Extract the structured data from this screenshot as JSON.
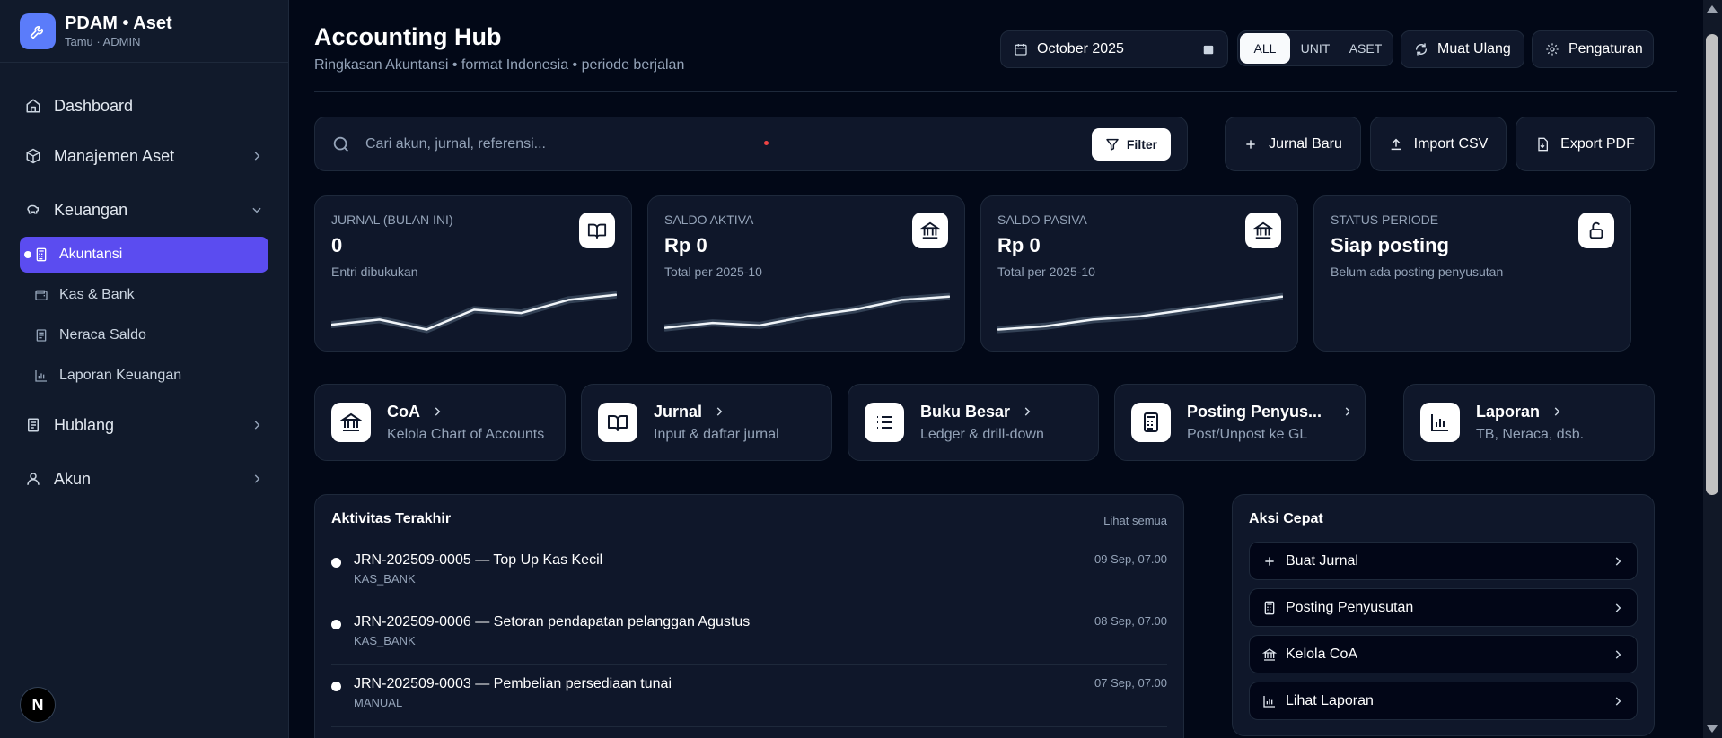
{
  "brand": {
    "title": "PDAM • Aset",
    "subtitle": "Tamu · ADMIN"
  },
  "sidebar": {
    "dashboard": "Dashboard",
    "aset": "Manajemen Aset",
    "keuangan": "Keuangan",
    "sub_items": [
      "Akuntansi",
      "Kas & Bank",
      "Neraca Saldo",
      "Laporan Keuangan"
    ],
    "hublang": "Hublang",
    "akun": "Akun",
    "badge": "N"
  },
  "header": {
    "title": "Accounting Hub",
    "subtitle": "Ringkasan Akuntansi • format Indonesia • periode berjalan",
    "period": "October 2025",
    "segments": [
      "ALL",
      "UNIT",
      "ASET"
    ],
    "reload": "Muat Ulang",
    "settings": "Pengaturan"
  },
  "toolbar": {
    "search_placeholder": "Cari akun, jurnal, referensi...",
    "filter": "Filter",
    "new_journal": "Jurnal Baru",
    "import": "Import CSV",
    "export": "Export PDF"
  },
  "kpis": [
    {
      "label": "Jurnal (bulan ini)",
      "value": "0",
      "note": "Entri dibukukan",
      "icon": "book-icon",
      "spark": [
        12,
        18,
        6,
        30,
        26,
        42,
        48
      ]
    },
    {
      "label": "Saldo Aktiva",
      "value": "Rp 0",
      "note": "Total per 2025-10",
      "icon": "bank-icon",
      "spark": [
        8,
        14,
        11,
        22,
        30,
        42,
        46
      ]
    },
    {
      "label": "Saldo Pasiva",
      "value": "Rp 0",
      "note": "Total per 2025-10",
      "icon": "bank-icon",
      "spark": [
        6,
        10,
        18,
        22,
        30,
        38,
        46
      ]
    },
    {
      "label": "Status Periode",
      "value": "Siap posting",
      "note": "Belum ada posting penyusutan",
      "icon": "unlock-icon"
    }
  ],
  "shortcuts": [
    {
      "title": "CoA",
      "sub": "Kelola Chart of Accounts",
      "icon": "bank-icon"
    },
    {
      "title": "Jurnal",
      "sub": "Input & daftar jurnal",
      "icon": "book-icon"
    },
    {
      "title": "Buku Besar",
      "sub": "Ledger & drill-down",
      "icon": "list-icon"
    },
    {
      "title": "Posting Penyus...",
      "sub": "Post/Unpost ke GL",
      "icon": "calculator-icon"
    },
    {
      "title": "Laporan",
      "sub": "TB, Neraca, dsb.",
      "icon": "bar-chart-icon"
    }
  ],
  "activity": {
    "title": "Aktivitas Terakhir",
    "see_all": "Lihat semua",
    "rows": [
      {
        "title": "JRN-202509-0005 — Top Up Kas Kecil",
        "type": "KAS_BANK",
        "time": "09 Sep, 07.00"
      },
      {
        "title": "JRN-202509-0006 — Setoran pendapatan pelanggan Agustus",
        "type": "KAS_BANK",
        "time": "08 Sep, 07.00"
      },
      {
        "title": "JRN-202509-0003 — Pembelian persediaan tunai",
        "type": "MANUAL",
        "time": "07 Sep, 07.00"
      }
    ]
  },
  "quick": {
    "title": "Aksi Cepat",
    "items": [
      "Buat Jurnal",
      "Posting Penyusutan",
      "Kelola CoA",
      "Lihat Laporan"
    ]
  },
  "colors": {
    "accent": "#5b4cf0",
    "brand": "#5b7cfa",
    "bg": "#020817",
    "panel": "#0f172a"
  }
}
